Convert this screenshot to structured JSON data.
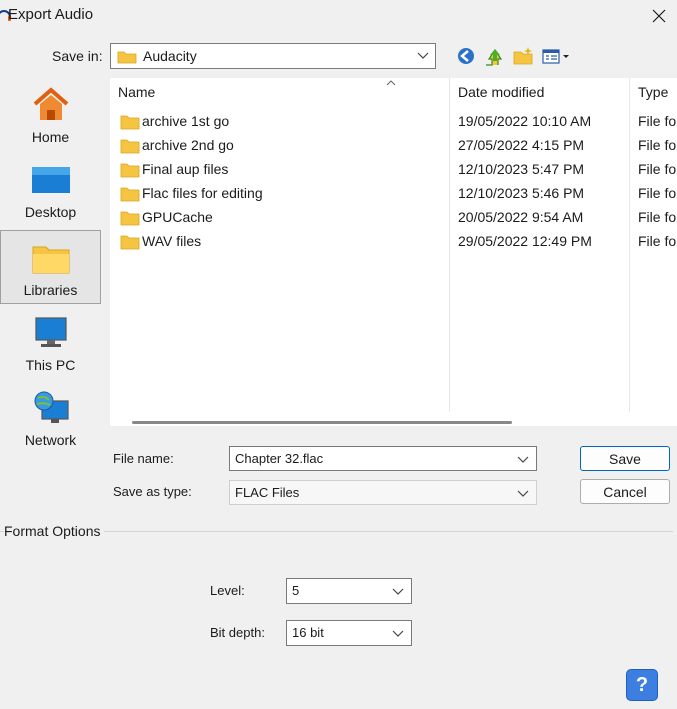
{
  "window": {
    "title": "Export Audio"
  },
  "save_in": {
    "label": "Save in:",
    "value": "Audacity"
  },
  "places": [
    {
      "label": "Home"
    },
    {
      "label": "Desktop"
    },
    {
      "label": "Libraries"
    },
    {
      "label": "This PC"
    },
    {
      "label": "Network"
    }
  ],
  "file_list": {
    "columns": {
      "name": "Name",
      "date": "Date modified",
      "type": "Type"
    },
    "rows": [
      {
        "name": "archive 1st go",
        "date": "19/05/2022 10:10 AM",
        "type": "File fo"
      },
      {
        "name": "archive 2nd go",
        "date": "27/05/2022 4:15 PM",
        "type": "File fo"
      },
      {
        "name": "Final aup files",
        "date": "12/10/2023 5:47 PM",
        "type": "File fo"
      },
      {
        "name": "Flac files for editing",
        "date": "12/10/2023 5:46 PM",
        "type": "File fo"
      },
      {
        "name": "GPUCache",
        "date": "20/05/2022 9:54 AM",
        "type": "File fo"
      },
      {
        "name": "WAV files",
        "date": "29/05/2022 12:49 PM",
        "type": "File fo"
      }
    ]
  },
  "file_name": {
    "label": "File name:",
    "value": "Chapter 32.flac"
  },
  "save_as_type": {
    "label": "Save as type:",
    "value": "FLAC Files"
  },
  "buttons": {
    "save": "Save",
    "cancel": "Cancel"
  },
  "format_options": {
    "title": "Format Options",
    "level": {
      "label": "Level:",
      "value": "5"
    },
    "bit_depth": {
      "label": "Bit depth:",
      "value": "16 bit"
    }
  },
  "help": {
    "glyph": "?"
  },
  "colors": {
    "folder": "#f5c542",
    "accent": "#0067c0",
    "help": "#3d7fe0"
  }
}
